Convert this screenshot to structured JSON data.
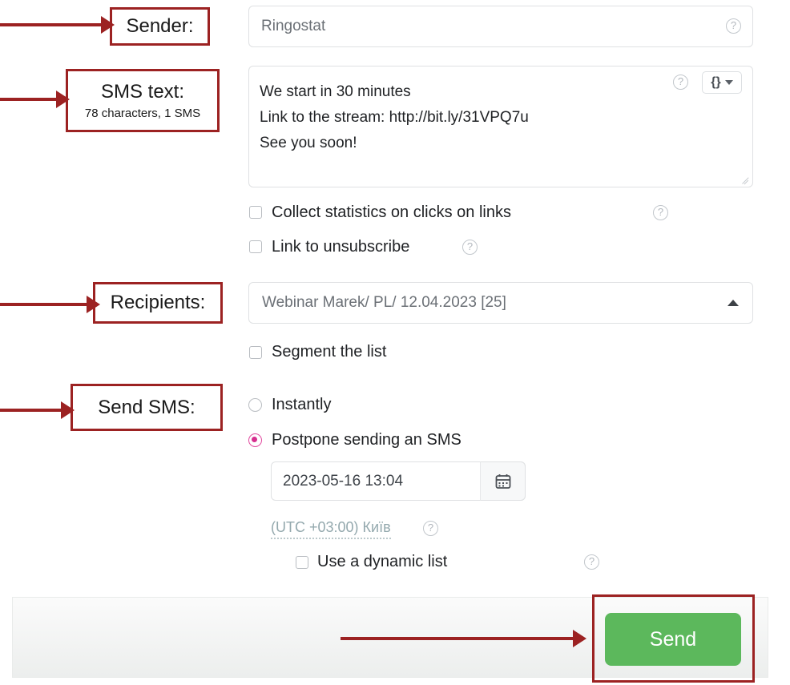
{
  "form": {
    "sender": {
      "value": "Ringostat",
      "help_icon": "help-circle-icon"
    },
    "sms_text": {
      "value": "We start in 30 minutes\nLink to the stream: http://bit.ly/31VPQ7u\nSee you soon!",
      "line1": "We start in 30 minutes",
      "line2": "Link to the stream: http://bit.ly/31VPQ7u",
      "line3": "See you soon!",
      "template_button_label": "{}",
      "help_icon": "help-circle-icon"
    },
    "options": [
      {
        "label": "Collect statistics on clicks on links",
        "checked": false,
        "has_help": true
      },
      {
        "label": "Link to unsubscribe",
        "checked": false,
        "has_help": true
      }
    ],
    "recipients": {
      "value": "Webinar Marek/ PL/ 12.04.2023 [25]",
      "chevron": "chevron-up-icon"
    },
    "segment": {
      "label": "Segment the list",
      "checked": false
    },
    "send_mode": {
      "instantly": {
        "label": "Instantly",
        "selected": false
      },
      "postpone": {
        "label": "Postpone sending an SMS",
        "selected": true
      }
    },
    "schedule": {
      "datetime": "2023-05-16 13:04",
      "calendar_icon": "calendar-icon",
      "timezone": "(UTC +03:00) Київ",
      "timezone_help_icon": "help-circle-icon"
    },
    "dynamic_list": {
      "label": "Use a dynamic list",
      "checked": false,
      "has_help": true
    },
    "footer": {
      "send_label": "Send"
    }
  },
  "annotations": [
    {
      "title": "Sender:",
      "sub": ""
    },
    {
      "title": "SMS text:",
      "sub": "78 characters, 1 SMS"
    },
    {
      "title": "Recipients:",
      "sub": ""
    },
    {
      "title": "Send SMS:",
      "sub": ""
    }
  ],
  "colors": {
    "annotation_red": "#9c2222",
    "send_green": "#5cb85c",
    "radio_pink": "#d62f8f",
    "timezone_teal": "#93a8ad"
  }
}
